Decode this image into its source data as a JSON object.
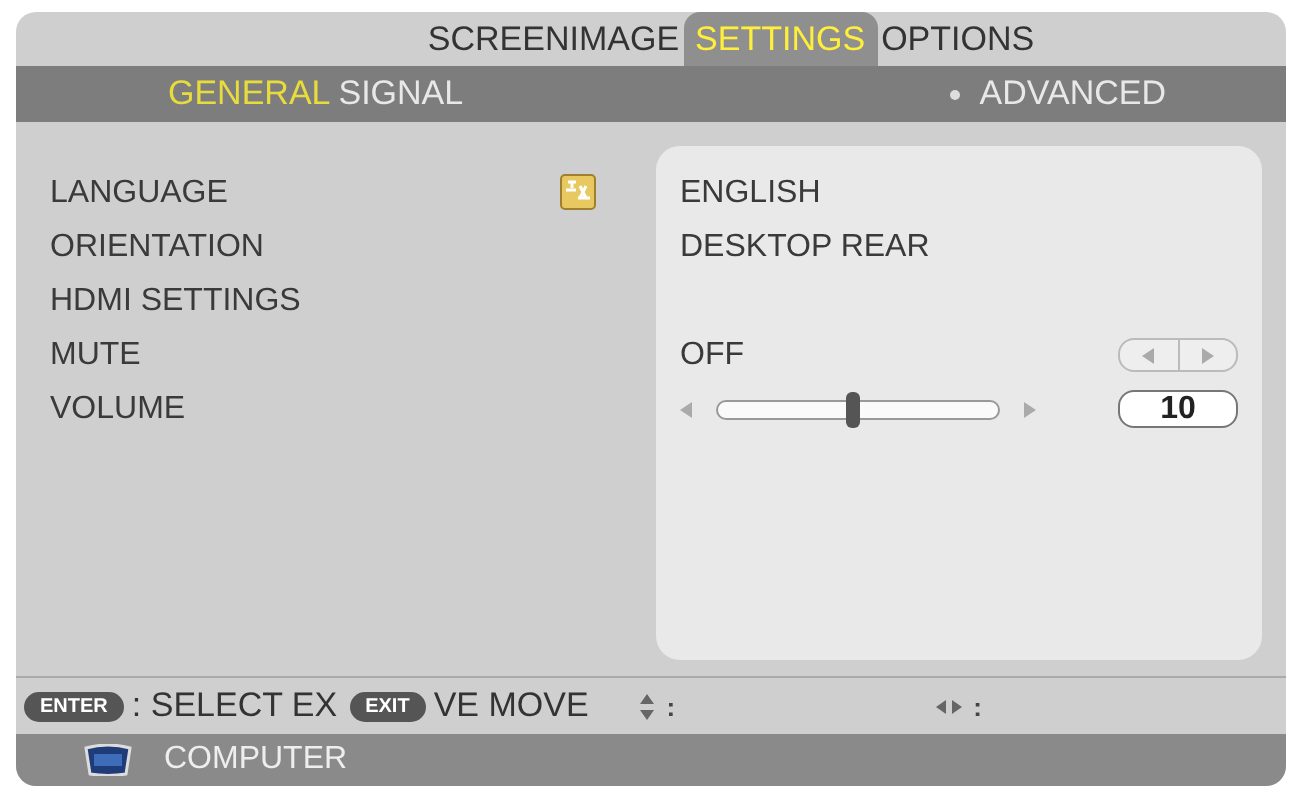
{
  "tabs": [
    {
      "label": "SCREENIMAGE",
      "selected": false
    },
    {
      "label": "SETTINGS",
      "selected": true
    },
    {
      "label": "OPTIONS",
      "selected": false
    }
  ],
  "subtabs": [
    {
      "label": "GENERAL",
      "selected": true
    },
    {
      "label": "SIGNAL",
      "selected": false
    },
    {
      "label": "ADVANCED",
      "selected": false,
      "kind": "bullet"
    }
  ],
  "settings": [
    {
      "label": "LANGUAGE",
      "kind": "value",
      "value": "ENGLISH",
      "icon": true
    },
    {
      "label": "ORIENTATION",
      "kind": "value",
      "value": "DESKTOP REAR"
    },
    {
      "label": "HDMI SETTINGS",
      "kind": "blank"
    },
    {
      "label": "MUTE",
      "kind": "toggle",
      "value": "OFF"
    },
    {
      "label": "VOLUME",
      "kind": "slider",
      "level": 0.48,
      "reading": "10"
    }
  ],
  "hints": [
    {
      "kind": "key",
      "text": "ENTER"
    },
    {
      "kind": "text",
      "text": ": SELECT EX"
    },
    {
      "kind": "key",
      "text": "EXIT"
    },
    {
      "kind": "text",
      "text": "VE MOVE"
    },
    {
      "kind": "updown",
      "text": ":"
    },
    {
      "kind": "leftright",
      "text": ":"
    }
  ],
  "status_bar": {
    "source": "COMPUTER"
  }
}
